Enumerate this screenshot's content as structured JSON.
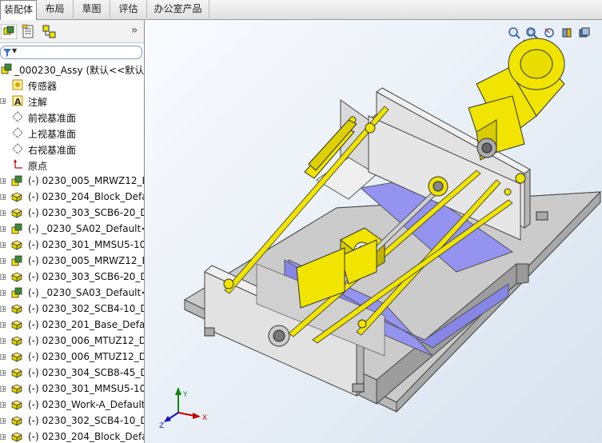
{
  "tabs": [
    "装配体",
    "布局",
    "草图",
    "评估",
    "办公室产品"
  ],
  "active_tab": 0,
  "panel": {
    "collapse_glyph": "»",
    "filter_glyph": "▼",
    "tree": [
      {
        "label": "_000230_Assy  (默认<<默认>",
        "icon": "assembly-icon",
        "expand": false
      },
      {
        "label": "传感器",
        "icon": "sensor-icon",
        "expand": false
      },
      {
        "label": "注解",
        "icon": "annotation-icon",
        "expand": true
      },
      {
        "label": "前视基准面",
        "icon": "plane-icon",
        "expand": false
      },
      {
        "label": "上视基准面",
        "icon": "plane-icon",
        "expand": false
      },
      {
        "label": "右视基准面",
        "icon": "plane-icon",
        "expand": false
      },
      {
        "label": "原点",
        "icon": "origin-icon",
        "expand": false
      },
      {
        "label": "(-) 0230_005_MRWZ12_D",
        "icon": "subassembly-icon",
        "expand": true
      },
      {
        "label": "(-) 0230_204_Block_Defau",
        "icon": "part-icon",
        "expand": true
      },
      {
        "label": "(-) 0230_303_SCB6-20_De",
        "icon": "part-icon",
        "expand": true
      },
      {
        "label": "(-) _0230_SA02_Default<1",
        "icon": "subassembly-icon",
        "expand": true
      },
      {
        "label": "(-) 0230_301_MMSU5-10_",
        "icon": "part-icon",
        "expand": true
      },
      {
        "label": "(-) 0230_005_MRWZ12_D",
        "icon": "subassembly-icon",
        "expand": true
      },
      {
        "label": "(-) 0230_303_SCB6-20_De",
        "icon": "part-icon",
        "expand": true
      },
      {
        "label": "(-) _0230_SA03_Default<1",
        "icon": "subassembly-icon",
        "expand": true
      },
      {
        "label": "(-) 0230_302_SCB4-10_De",
        "icon": "part-icon",
        "expand": true
      },
      {
        "label": "(-) 0230_201_Base_Defau",
        "icon": "part-icon",
        "expand": true
      },
      {
        "label": "(-) 0230_006_MTUZ12_De",
        "icon": "part-icon",
        "expand": true
      },
      {
        "label": "(-) 0230_006_MTUZ12_De",
        "icon": "part-icon",
        "expand": true
      },
      {
        "label": "(-) 0230_304_SCB8-45_De",
        "icon": "part-icon",
        "expand": true
      },
      {
        "label": "(-) 0230_301_MMSU5-10_",
        "icon": "part-icon",
        "expand": true
      },
      {
        "label": "(-) 0230_Work-A_Default",
        "icon": "part-icon",
        "expand": true
      },
      {
        "label": "(-) 0230_302_SCB4-10_De",
        "icon": "part-icon",
        "expand": true
      },
      {
        "label": "(-) 0230_204_Block_Defau",
        "icon": "part-icon",
        "expand": true
      }
    ]
  },
  "viewport": {
    "tools": [
      "zoom-to-fit-icon",
      "zoom-area-icon",
      "previous-view-icon",
      "section-view-icon",
      "view-orientation-icon"
    ],
    "triad": {
      "x": "X",
      "y": "Y",
      "z": "Z"
    }
  },
  "colors": {
    "yellow": "#f0e400",
    "blue": "#9494f0",
    "gray": "#c8c8c8"
  }
}
